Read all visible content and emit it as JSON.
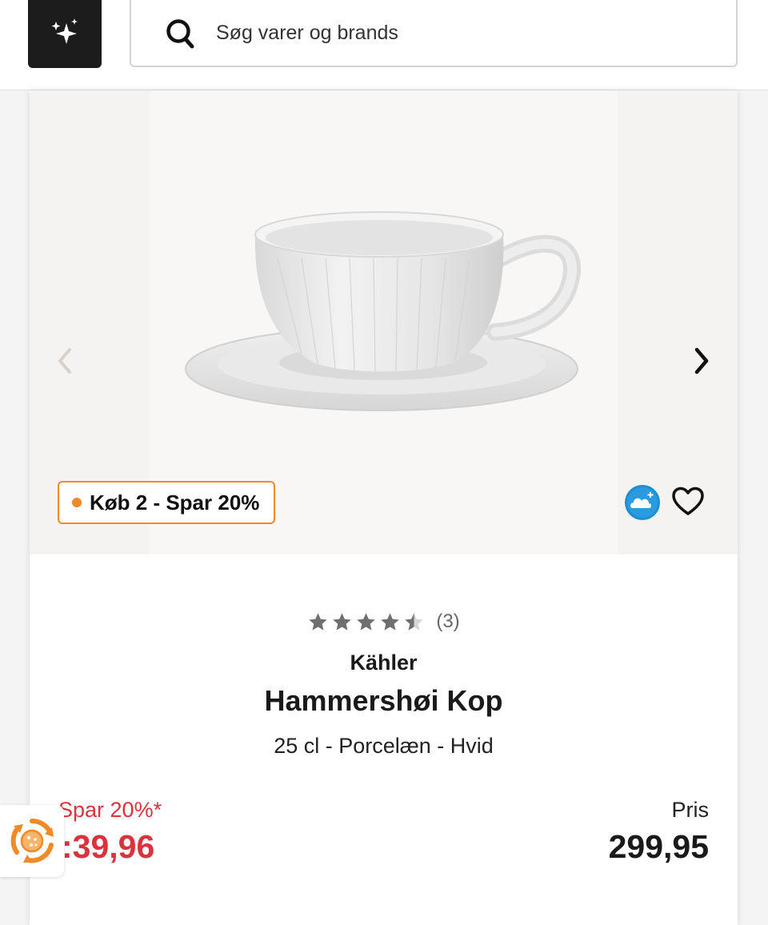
{
  "header": {
    "search_placeholder": "Søg varer og brands",
    "ai_button_icon": "sparkles-icon",
    "search_icon": "search-icon"
  },
  "product": {
    "image_alt": "white ribbed porcelain cup on saucer",
    "promo_label": "Køb 2 - Spar 20%",
    "rating": {
      "stars": 4.5,
      "max": 5,
      "count_label": "(3)"
    },
    "brand": "Kähler",
    "name": "Hammershøi Kop",
    "variant": "25 cl - Porcelæn - Hvid",
    "save_label": "Spar 20%*",
    "sale_price": ":39,96",
    "price_label": "Pris",
    "price": "299,95"
  },
  "colors": {
    "accent_orange": "#f08a24",
    "sale_red": "#d8343d",
    "cloud_blue": "#1b8fd2",
    "dark": "#1c1c1c"
  },
  "icons": [
    "sparkles-icon",
    "search-icon",
    "chevron-left-icon",
    "chevron-right-icon",
    "cloud-plus-icon",
    "heart-icon",
    "star-icon",
    "cookie-settings-icon"
  ]
}
